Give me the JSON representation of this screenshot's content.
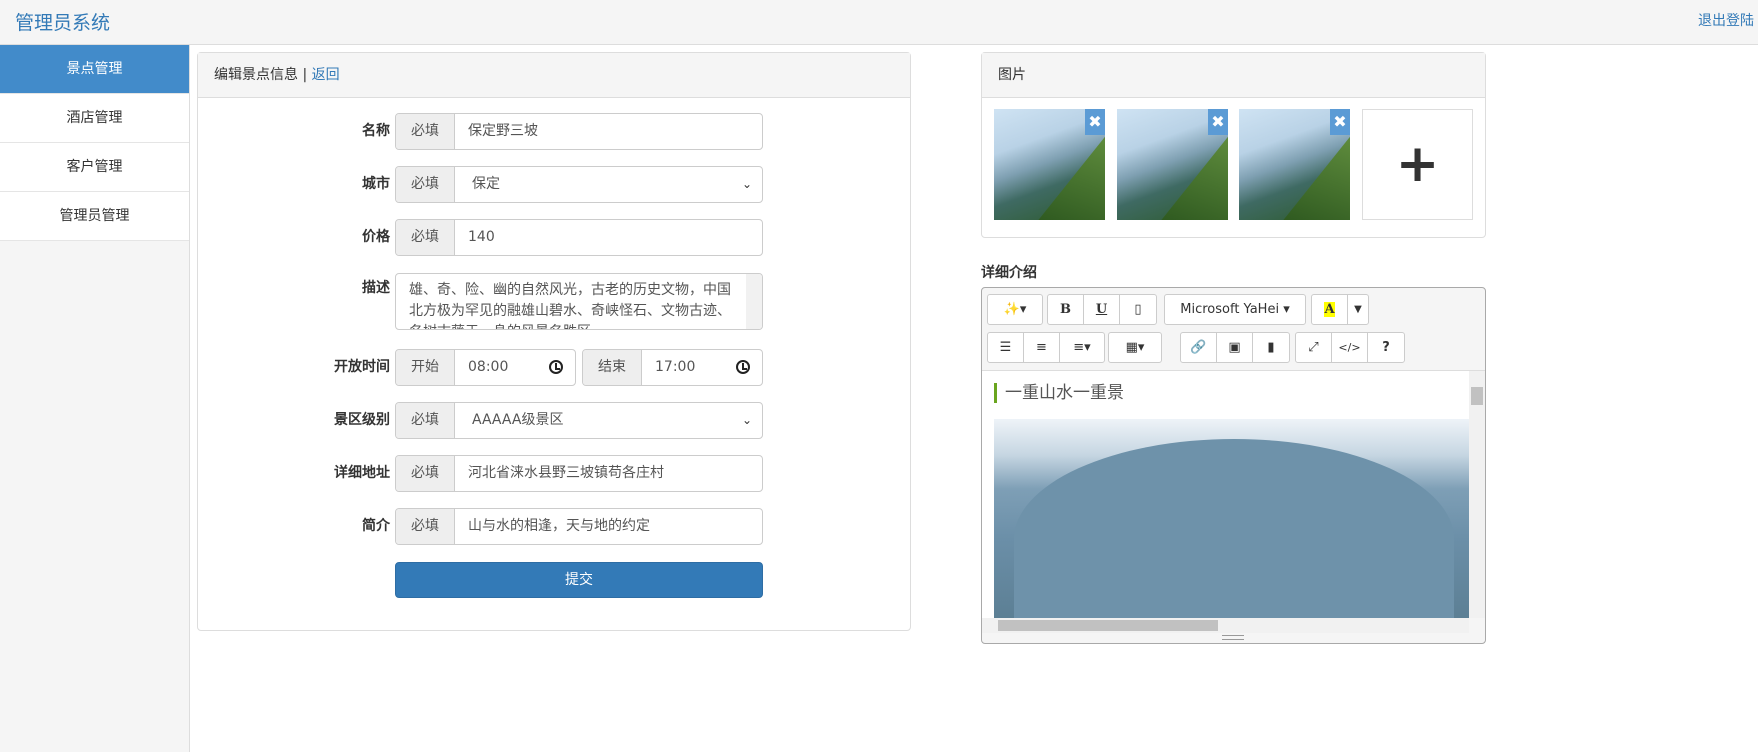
{
  "header": {
    "brand": "管理员系统",
    "logout": "退出登陆"
  },
  "sidebar": {
    "items": [
      {
        "label": "景点管理",
        "active": true
      },
      {
        "label": "酒店管理"
      },
      {
        "label": "客户管理"
      },
      {
        "label": "管理员管理"
      }
    ]
  },
  "form": {
    "title": "编辑景点信息",
    "separator": "|",
    "back": "返回",
    "required": "必填",
    "name": {
      "label": "名称",
      "value": "保定野三坡"
    },
    "city": {
      "label": "城市",
      "value": "保定"
    },
    "price": {
      "label": "价格",
      "value": "140"
    },
    "desc": {
      "label": "描述",
      "value": "雄、奇、险、幽的自然风光，古老的历史文物，中国北方极为罕见的融雄山碧水、奇峡怪石、文物古迹、名树古藤于一身的风景名胜区。"
    },
    "hours": {
      "label": "开放时间",
      "start_label": "开始",
      "start": "08:00",
      "end_label": "结束",
      "end": "17:00"
    },
    "level": {
      "label": "景区级别",
      "value": "AAAAA级景区"
    },
    "address": {
      "label": "详细地址",
      "value": "河北省涞水县野三坡镇苟各庄村"
    },
    "intro": {
      "label": "简介",
      "value": "山与水的相逢，天与地的约定"
    },
    "submit": "提交"
  },
  "images": {
    "title": "图片",
    "count": 3,
    "add": "+",
    "remove": "✖"
  },
  "editor": {
    "label": "详细介绍",
    "font": "Microsoft YaHei",
    "toolbar": {
      "bold": "B",
      "underline": "U",
      "highlight": "A",
      "code": "</>",
      "help": "?"
    },
    "heading": "一重山水一重景"
  }
}
